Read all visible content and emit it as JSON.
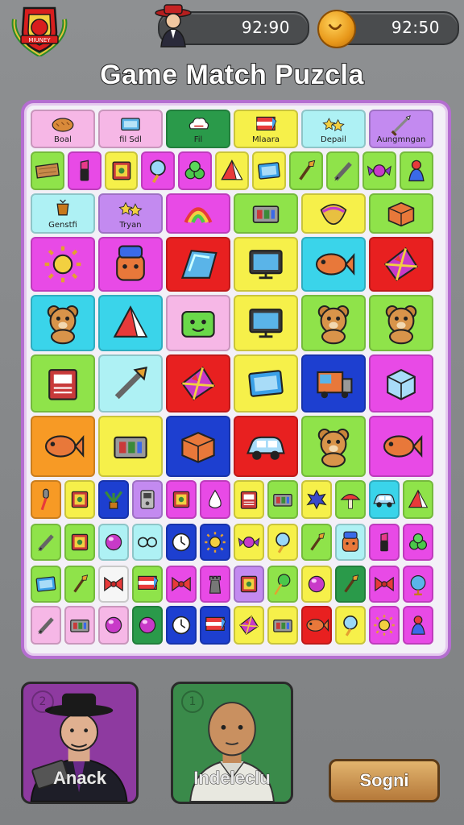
{
  "hud": {
    "badge_icon": "shield-crest-icon",
    "badge_text": "MIUNEY",
    "player_timer": "92:90",
    "coin_timer": "92:50"
  },
  "title": "Game Match Puzcla",
  "board": {
    "rows": [
      [
        {
          "icon": "bread",
          "label": "Boal",
          "color": "#f6b7e6"
        },
        {
          "icon": "tablet",
          "label": "fil Sdl",
          "color": "#f6b7e6"
        },
        {
          "icon": "cloud",
          "label": "Fil",
          "color": "#2a9a4a"
        },
        {
          "icon": "flag",
          "label": "Mlaara",
          "color": "#f6f04a"
        },
        {
          "icon": "stars",
          "label": "Depail",
          "color": "#aef1f4"
        },
        {
          "icon": "sword",
          "label": "Aungmngan",
          "color": "#c38af0"
        }
      ],
      [
        {
          "icon": "plank",
          "color": "#8fe34a"
        },
        {
          "icon": "lipstick",
          "color": "#e84ae6"
        },
        {
          "icon": "card",
          "color": "#f6f04a"
        },
        {
          "icon": "mirror",
          "color": "#e84ae6"
        },
        {
          "icon": "leaf",
          "color": "#e84ae6"
        },
        {
          "icon": "tent",
          "color": "#f6f04a"
        },
        {
          "icon": "screen",
          "color": "#f6f04a"
        },
        {
          "icon": "brush",
          "color": "#8fe34a"
        },
        {
          "icon": "pencil",
          "color": "#8fe34a"
        },
        {
          "icon": "candy",
          "color": "#8fe34a"
        },
        {
          "icon": "figure",
          "color": "#8fe34a"
        }
      ],
      [
        {
          "icon": "cup",
          "label": "Genstfi",
          "color": "#aef1f4"
        },
        {
          "icon": "stars",
          "label": "Tryan",
          "color": "#c38af0"
        },
        {
          "icon": "rainbow",
          "color": "#e84ae6"
        },
        {
          "icon": "chest",
          "color": "#8fe34a"
        },
        {
          "icon": "shell",
          "color": "#f6f04a"
        },
        {
          "icon": "box",
          "color": "#8fe34a"
        }
      ],
      [
        {
          "icon": "sun",
          "color": "#e84ae6"
        },
        {
          "icon": "face",
          "color": "#e84ae6"
        },
        {
          "icon": "glass",
          "color": "#e82020"
        },
        {
          "icon": "monitor",
          "color": "#f6f04a"
        },
        {
          "icon": "fish",
          "color": "#3ad4ea"
        },
        {
          "icon": "kite",
          "color": "#e82020"
        }
      ],
      [
        {
          "icon": "bear",
          "color": "#3ad4ea"
        },
        {
          "icon": "tent",
          "color": "#3ad4ea"
        },
        {
          "icon": "cat",
          "color": "#f6b7e6"
        },
        {
          "icon": "monitor",
          "color": "#f6f04a"
        },
        {
          "icon": "bear",
          "color": "#8fe34a"
        },
        {
          "icon": "bear",
          "color": "#8fe34a"
        }
      ],
      [
        {
          "icon": "book",
          "color": "#8fe34a"
        },
        {
          "icon": "arrow",
          "color": "#aef1f4"
        },
        {
          "icon": "kite",
          "color": "#e82020"
        },
        {
          "icon": "screen",
          "color": "#f6f04a"
        },
        {
          "icon": "truck",
          "color": "#1d3fd0"
        },
        {
          "icon": "cube",
          "color": "#e84ae6"
        }
      ],
      [
        {
          "icon": "fish",
          "color": "#f79a25"
        },
        {
          "icon": "chest",
          "color": "#f6f04a"
        },
        {
          "icon": "box",
          "color": "#1d3fd0"
        },
        {
          "icon": "car",
          "color": "#e82020"
        },
        {
          "icon": "bear",
          "color": "#8fe34a"
        },
        {
          "icon": "fish",
          "color": "#e84ae6"
        }
      ],
      [
        {
          "icon": "mic",
          "color": "#f79a25"
        },
        {
          "icon": "card",
          "color": "#f6f04a"
        },
        {
          "icon": "plant",
          "color": "#1d3fd0"
        },
        {
          "icon": "robot",
          "color": "#c38af0"
        },
        {
          "icon": "card",
          "color": "#e84ae6"
        },
        {
          "icon": "drop",
          "color": "#e84ae6"
        },
        {
          "icon": "book",
          "color": "#f6f04a"
        },
        {
          "icon": "chest",
          "color": "#8fe34a"
        },
        {
          "icon": "splat",
          "color": "#f6f04a"
        },
        {
          "icon": "mushroom",
          "color": "#8fe34a"
        },
        {
          "icon": "car",
          "color": "#3ad4ea"
        },
        {
          "icon": "tent",
          "color": "#8fe34a"
        }
      ],
      [
        {
          "icon": "pencil",
          "color": "#8fe34a"
        },
        {
          "icon": "card",
          "color": "#8fe34a"
        },
        {
          "icon": "ball",
          "color": "#aef1f4"
        },
        {
          "icon": "glasses",
          "color": "#aef1f4"
        },
        {
          "icon": "clock",
          "color": "#1d3fd0"
        },
        {
          "icon": "sun",
          "color": "#1d3fd0"
        },
        {
          "icon": "candy",
          "color": "#f6f04a"
        },
        {
          "icon": "mirror",
          "color": "#f6f04a"
        },
        {
          "icon": "brush",
          "color": "#8fe34a"
        },
        {
          "icon": "face",
          "color": "#aef1f4"
        },
        {
          "icon": "lipstick",
          "color": "#e84ae6"
        },
        {
          "icon": "leaf",
          "color": "#e84ae6"
        }
      ],
      [
        {
          "icon": "screen",
          "color": "#8fe34a"
        },
        {
          "icon": "brush",
          "color": "#8fe34a"
        },
        {
          "icon": "bow",
          "color": "#f6f6f6"
        },
        {
          "icon": "flag",
          "color": "#8fe34a"
        },
        {
          "icon": "bow",
          "color": "#e84ae6"
        },
        {
          "icon": "tower",
          "color": "#e84ae6"
        },
        {
          "icon": "card",
          "color": "#c38af0"
        },
        {
          "icon": "lollipop",
          "color": "#8fe34a"
        },
        {
          "icon": "ball",
          "color": "#f6f04a"
        },
        {
          "icon": "brush",
          "color": "#2a9a4a"
        },
        {
          "icon": "bow",
          "color": "#e84ae6"
        },
        {
          "icon": "globe",
          "color": "#e84ae6"
        }
      ],
      [
        {
          "icon": "pencil",
          "color": "#f6b7e6"
        },
        {
          "icon": "chest",
          "color": "#f6b7e6"
        },
        {
          "icon": "ball",
          "color": "#f6b7e6"
        },
        {
          "icon": "ball",
          "color": "#2a9a4a"
        },
        {
          "icon": "clock",
          "color": "#1d3fd0"
        },
        {
          "icon": "flag",
          "color": "#1d3fd0"
        },
        {
          "icon": "kite",
          "color": "#f6f04a"
        },
        {
          "icon": "chest",
          "color": "#f6f04a"
        },
        {
          "icon": "fish",
          "color": "#e82020"
        },
        {
          "icon": "mirror",
          "color": "#f6f04a"
        },
        {
          "icon": "sun",
          "color": "#e84ae6"
        },
        {
          "icon": "figure",
          "color": "#e84ae6"
        }
      ]
    ]
  },
  "players": [
    {
      "number": "2",
      "name": "Anack",
      "color": "#8e3aa0"
    },
    {
      "number": "1",
      "name": "Indeleclu",
      "color": "#3a8a4a"
    }
  ],
  "action_button": "Sogni"
}
